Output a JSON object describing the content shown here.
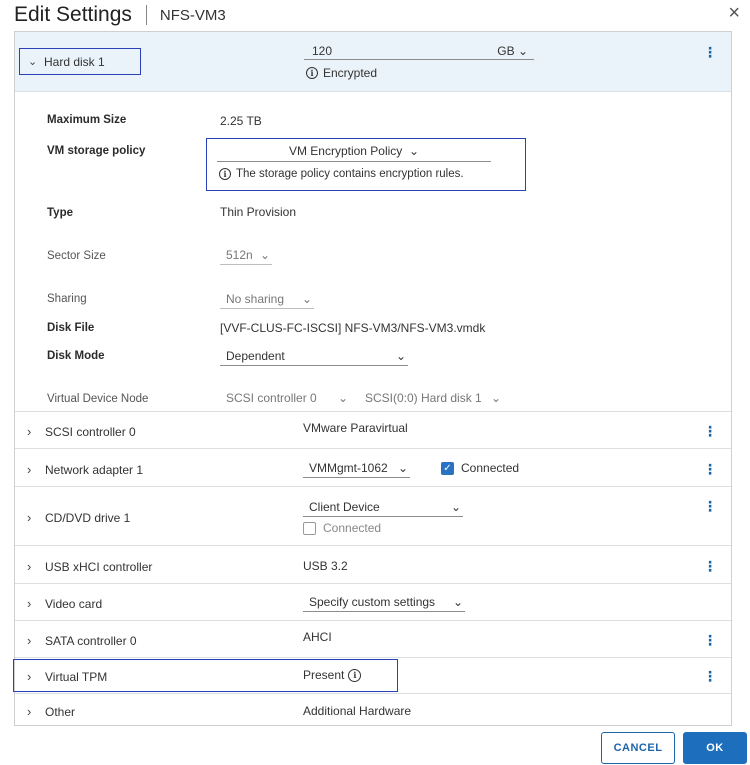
{
  "header": {
    "title": "Edit Settings",
    "vm_name": "NFS-VM3",
    "close_glyph": "×"
  },
  "hard_disk": {
    "label": "Hard disk 1",
    "size_value": "120",
    "size_unit": "GB",
    "encrypted_text": "Encrypted",
    "details": {
      "max_size_label": "Maximum Size",
      "max_size_value": "2.25 TB",
      "storage_policy_label": "VM storage policy",
      "storage_policy_value": "VM Encryption Policy",
      "storage_policy_note": "The storage policy contains encryption rules.",
      "type_label": "Type",
      "type_value": "Thin Provision",
      "sector_size_label": "Sector Size",
      "sector_size_value": "512n",
      "sharing_label": "Sharing",
      "sharing_value": "No sharing",
      "disk_file_label": "Disk File",
      "disk_file_value": "[VVF-CLUS-FC-ISCSI] NFS-VM3/NFS-VM3.vmdk",
      "disk_mode_label": "Disk Mode",
      "disk_mode_value": "Dependent",
      "vdn_label": "Virtual Device Node",
      "vdn_controller": "SCSI controller 0",
      "vdn_slot": "SCSI(0:0) Hard disk 1"
    }
  },
  "devices": {
    "scsi": {
      "label": "SCSI controller 0",
      "value": "VMware Paravirtual"
    },
    "network": {
      "label": "Network adapter 1",
      "value": "VMMgmt-1062",
      "connected_label": "Connected"
    },
    "cddvd": {
      "label": "CD/DVD drive 1",
      "value": "Client Device",
      "connected_label": "Connected"
    },
    "usb": {
      "label": "USB xHCI controller",
      "value": "USB 3.2"
    },
    "video": {
      "label": "Video card",
      "value": "Specify custom settings"
    },
    "sata": {
      "label": "SATA controller 0",
      "value": "AHCI"
    },
    "tpm": {
      "label": "Virtual TPM",
      "value": "Present"
    },
    "other": {
      "label": "Other",
      "value": "Additional Hardware"
    }
  },
  "buttons": {
    "cancel": "CANCEL",
    "ok": "OK"
  },
  "icons": {
    "chevron_down": "chevron-down-icon",
    "chevron_right": "chevron-right-icon",
    "kebab": "kebab-menu-icon",
    "info": "info-icon",
    "check": "check-icon",
    "close": "close-icon"
  },
  "colors": {
    "accent": "#1d6fbd",
    "highlight_border": "#2a40b8",
    "header_bg": "#e9f3f9"
  }
}
